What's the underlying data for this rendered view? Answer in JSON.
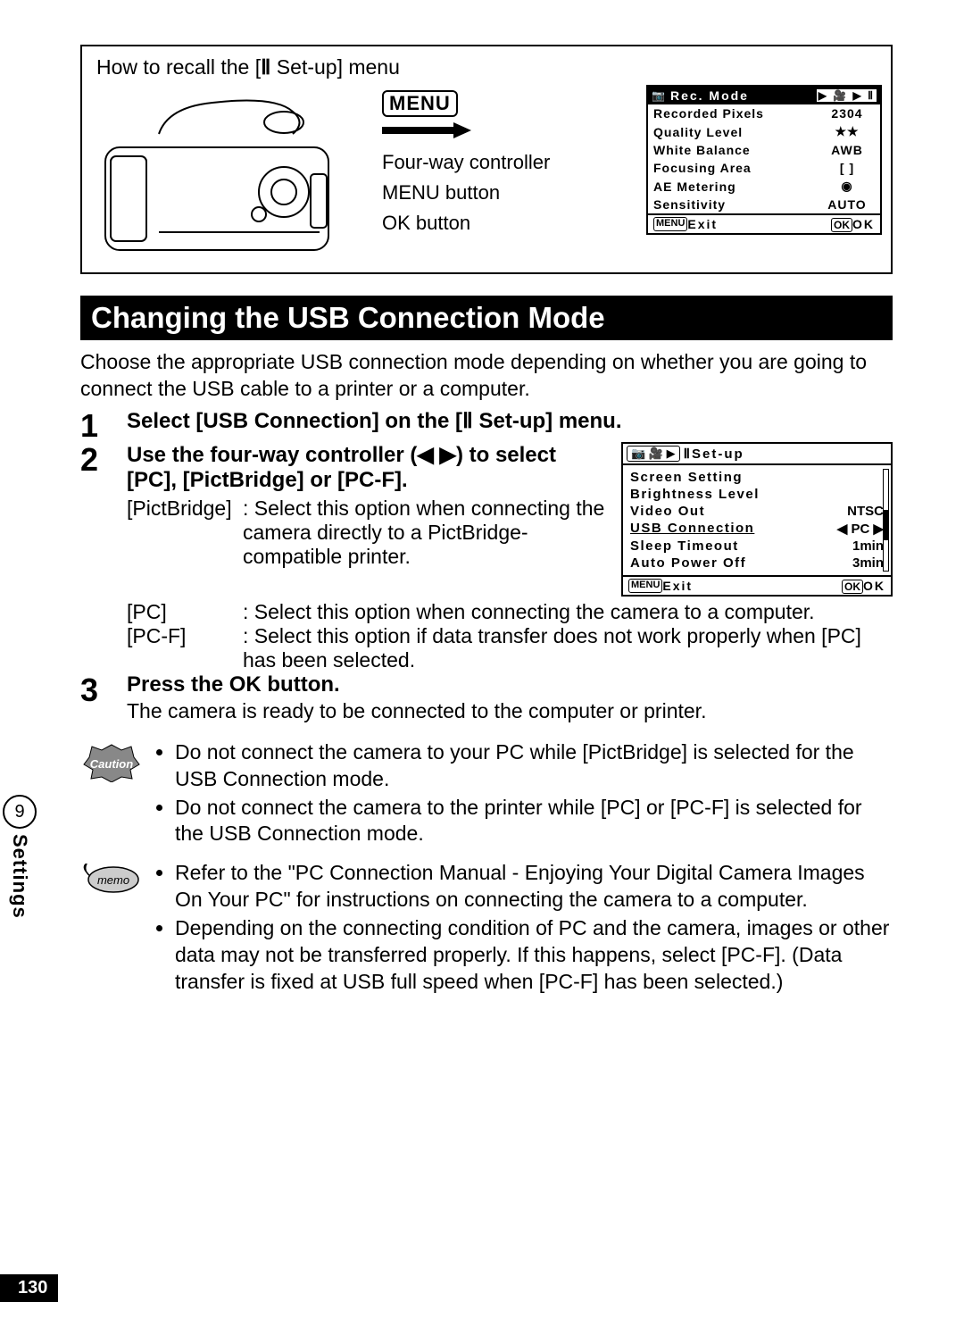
{
  "topbox": {
    "title_pre": "How to recall the [",
    "title_post": " Set-up] menu",
    "labels": {
      "menu": "MENU",
      "fourway": "Four-way controller",
      "menubutton": "MENU button",
      "okbutton": "OK button"
    }
  },
  "lcd1": {
    "header_icon": "📷",
    "header_title": "Rec. Mode",
    "rows": [
      {
        "k": "Recorded Pixels",
        "v": "2304"
      },
      {
        "k": "Quality Level",
        "v": "★★"
      },
      {
        "k": "White Balance",
        "v": "AWB"
      },
      {
        "k": "Focusing Area",
        "v": "[   ]"
      },
      {
        "k": "AE Metering",
        "v": "◉"
      },
      {
        "k": "Sensitivity",
        "v": "AUTO"
      }
    ],
    "footer_menu": "MENU",
    "footer_exit": "Exit",
    "footer_ok_badge": "OK",
    "footer_ok": "OK"
  },
  "heading": "Changing the USB Connection Mode",
  "intro": "Choose the appropriate USB connection mode depending on whether you are going to connect the USB cable to a printer or a computer.",
  "step1": {
    "n": "1",
    "title_pre": "Select [USB Connection] on the [",
    "title_post": " Set-up] menu."
  },
  "step2": {
    "n": "2",
    "title": "Use the four-way controller (◀ ▶) to select [PC], [PictBridge] or [PC-F].",
    "opts": {
      "pictbridge_k": "[PictBridge]",
      "pictbridge_v": ": Select this option when connecting the camera directly to a PictBridge-compatible printer.",
      "pc_k": "[PC]",
      "pc_v": ": Select this option when connecting the camera to a computer.",
      "pcf_k": "[PC-F]",
      "pcf_v": ": Select this option if data transfer does not work properly when [PC] has been selected."
    }
  },
  "step3": {
    "n": "3",
    "title": "Press the OK button.",
    "body": "The camera is ready to be connected to the computer or printer."
  },
  "lcd2": {
    "setup": "Set-up",
    "rows": {
      "screen": "Screen Setting",
      "bright": "Brightness Level",
      "video": "Video Out",
      "video_v": "NTSC",
      "usb": "USB Connection",
      "usb_v": "◀  PC  ▶",
      "sleep": "Sleep Timeout",
      "sleep_v": "1min",
      "auto": "Auto Power Off",
      "auto_v": "3min"
    },
    "footer_menu": "MENU",
    "footer_exit": "Exit",
    "footer_ok_badge": "OK",
    "footer_ok": "OK"
  },
  "caution": {
    "label": "Caution",
    "b1": "Do not connect the camera to your PC while [PictBridge] is selected for the USB Connection mode.",
    "b2": "Do not connect the camera to the printer while [PC] or [PC-F] is selected for the USB Connection mode."
  },
  "memo": {
    "label": "memo",
    "b1": "Refer to the \"PC Connection Manual - Enjoying Your Digital Camera Images On Your PC\" for instructions on connecting the camera to a computer.",
    "b2": "Depending on the connecting condition of PC and the camera, images or other data may not be transferred properly. If this happens, select [PC-F]. (Data transfer is fixed at USB full speed when [PC-F] has been selected.)"
  },
  "sidebar": {
    "num": "9",
    "label": "Settings"
  },
  "pagenum": "130"
}
